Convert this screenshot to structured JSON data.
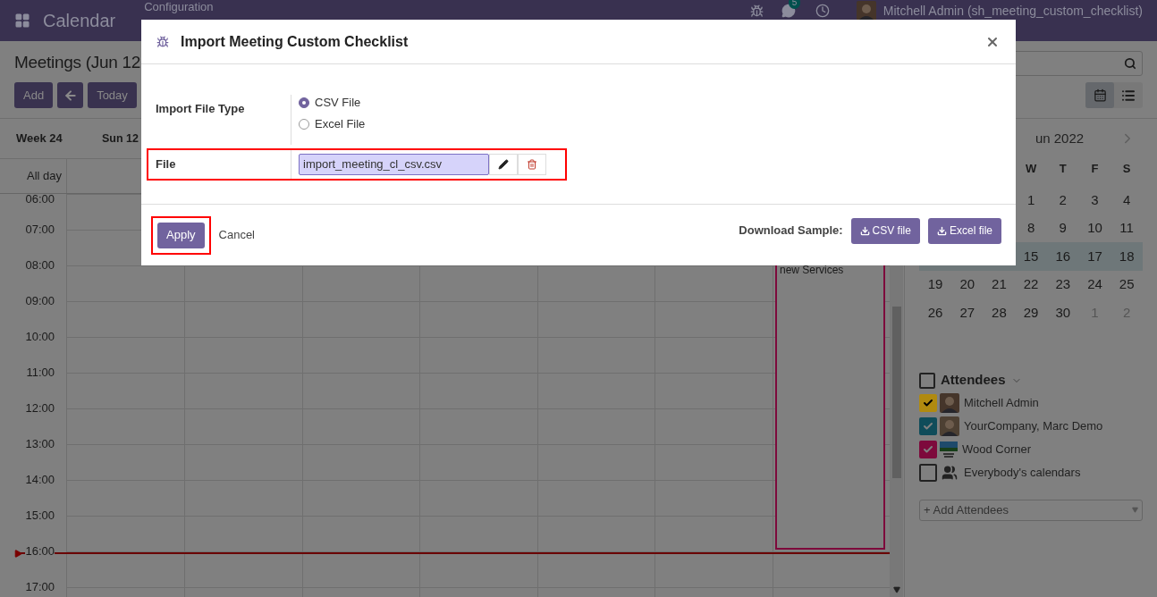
{
  "navbar": {
    "app_title": "Calendar",
    "menu": [
      "Configuration"
    ],
    "chat_badge": "5",
    "user": "Mitchell Admin (sh_meeting_custom_checklist)"
  },
  "control_panel": {
    "title": "Meetings (Jun 12",
    "buttons": [
      {
        "kind": "text",
        "label": "Add"
      },
      {
        "kind": "prev"
      },
      {
        "kind": "text",
        "label": "Today"
      }
    ],
    "views": [
      {
        "kind": "calendar",
        "selected": true
      },
      {
        "kind": "list",
        "selected": false
      }
    ]
  },
  "calendar": {
    "week": "Week 24",
    "day_headers": [
      "Sun 12"
    ],
    "all_day": "All day",
    "hours": [
      "06:00",
      "07:00",
      "08:00",
      "09:00",
      "10:00",
      "11:00",
      "12:00",
      "13:00",
      "14:00",
      "15:00",
      "16:00",
      "17:00"
    ],
    "event": {
      "title": "new Services"
    }
  },
  "mini_calendar": {
    "month": "un 2022",
    "weekdays": [
      "W",
      "T",
      "F",
      "S"
    ],
    "weeks": [
      {
        "current": false,
        "days": [
          {
            "label": "1",
            "other_month": false
          },
          {
            "label": "2",
            "other_month": false
          },
          {
            "label": "3",
            "other_month": false
          },
          {
            "label": "4",
            "other_month": false
          }
        ]
      },
      {
        "current": false,
        "days": [
          {
            "label": "8",
            "other_month": false
          },
          {
            "label": "9",
            "other_month": false
          },
          {
            "label": "10",
            "other_month": false
          },
          {
            "label": "11",
            "other_month": false
          }
        ]
      },
      {
        "current": true,
        "days": [
          {
            "label": "15",
            "other_month": false
          },
          {
            "label": "16",
            "other_month": false
          },
          {
            "label": "17",
            "other_month": false
          },
          {
            "label": "18",
            "other_month": false
          }
        ]
      },
      {
        "current": false,
        "days": [
          {
            "label": "19",
            "other_month": false
          },
          {
            "label": "20",
            "other_month": false
          },
          {
            "label": "21",
            "other_month": false
          },
          {
            "label": "22",
            "other_month": false
          },
          {
            "label": "23",
            "other_month": false
          },
          {
            "label": "24",
            "other_month": false
          },
          {
            "label": "25",
            "other_month": false
          }
        ]
      },
      {
        "current": false,
        "days": [
          {
            "label": "26",
            "other_month": false
          },
          {
            "label": "27",
            "other_month": false
          },
          {
            "label": "28",
            "other_month": false
          },
          {
            "label": "29",
            "other_month": false
          },
          {
            "label": "30",
            "other_month": false
          },
          {
            "label": "1",
            "other_month": true
          },
          {
            "label": "2",
            "other_month": true
          }
        ]
      }
    ]
  },
  "attendees": {
    "title": "Attendees",
    "checked": false,
    "items": [
      {
        "kind": "user",
        "name": "Mitchell Admin",
        "checked": true,
        "color": "#b08a10"
      },
      {
        "kind": "user",
        "name": "YourCompany, Marc Demo",
        "checked": true,
        "color": "#0f4c5a"
      },
      {
        "kind": "company",
        "name": "Wood Corner",
        "checked": true,
        "color": "#7d0a3c"
      },
      {
        "kind": "group",
        "name": "Everybody's calendars",
        "checked": false
      }
    ],
    "add_placeholder": "+ Add Attendees"
  },
  "dialog": {
    "title": "Import Meeting Custom Checklist",
    "fields": [
      {
        "kind": "radio",
        "label": "Import File Type",
        "highlighted": false,
        "options": [
          {
            "label": "CSV File",
            "selected": true
          },
          {
            "label": "Excel File",
            "selected": false
          }
        ]
      },
      {
        "kind": "file",
        "label": "File",
        "value": "import_meeting_cl_csv.csv",
        "highlighted": true
      }
    ],
    "apply": {
      "label": "Apply",
      "highlighted": true
    },
    "cancel": "Cancel",
    "download_label": "Download Sample:",
    "downloads": [
      "CSV file",
      "Excel file"
    ]
  }
}
